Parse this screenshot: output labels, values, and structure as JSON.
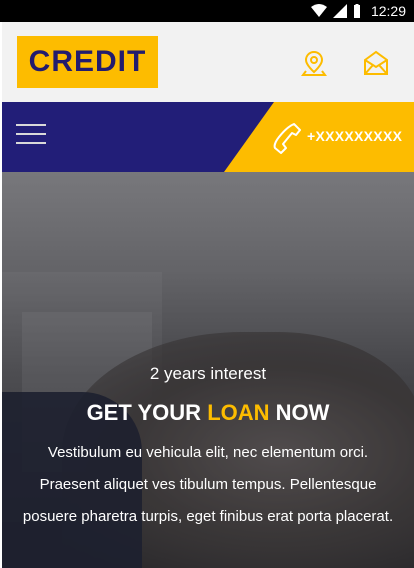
{
  "status_bar": {
    "time": "12:29",
    "icons": [
      "wifi-icon",
      "signal-icon",
      "battery-icon"
    ]
  },
  "header": {
    "logo": "CREDIT",
    "icons": [
      "location-icon",
      "mail-icon"
    ]
  },
  "nav": {
    "menu_icon": "hamburger-icon",
    "phone_icon": "phone-icon",
    "phone_number": "+XXXXXXXXX"
  },
  "hero": {
    "subtitle": "2 years interest",
    "title_prefix": "GET YOUR",
    "title_accent": "LOAN",
    "title_suffix": "NOW",
    "description": "Vestibulum eu vehicula elit, nec elementum orci. Praesent aliquet ves tibulum tempus. Pellentesque posuere pharetra turpis, eget finibus erat porta placerat."
  },
  "colors": {
    "brand_yellow": "#fdbc00",
    "brand_navy": "#221e78"
  }
}
